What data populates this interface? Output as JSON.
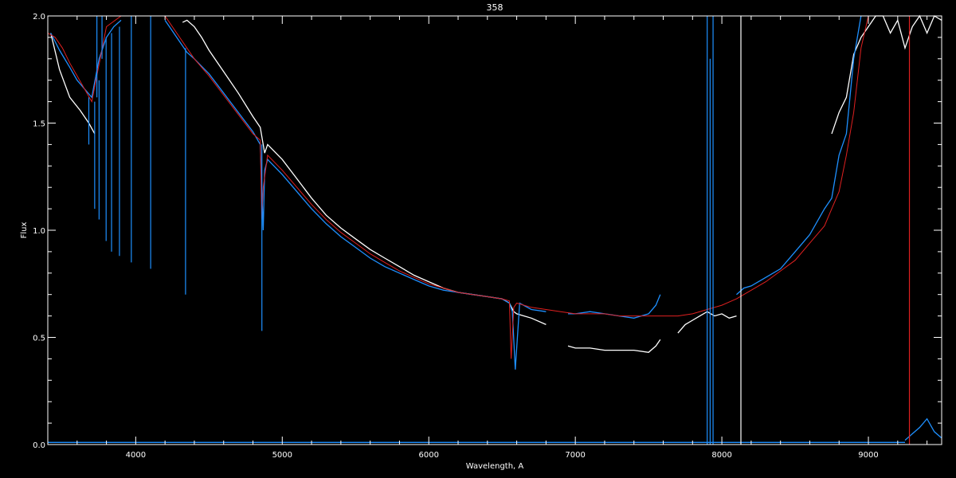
{
  "chart_data": {
    "type": "line",
    "title": "358",
    "xlabel": "Wavelength, A",
    "ylabel": "Flux",
    "xlim": [
      3400,
      9500
    ],
    "ylim": [
      0.0,
      2.0
    ],
    "x_ticks": [
      4000,
      5000,
      6000,
      7000,
      8000,
      9000
    ],
    "x_tick_labels": [
      "4000",
      "5000",
      "6000",
      "7000",
      "8000",
      "9000"
    ],
    "y_ticks": [
      0.0,
      0.5,
      1.0,
      1.5,
      2.0
    ],
    "y_tick_labels": [
      "0.0",
      "0.5",
      "1.0",
      "1.5",
      "2.0"
    ],
    "grid": false,
    "background_color": "#000000",
    "axes_color": "#ffffff",
    "series": [
      {
        "color": "#ffffff",
        "segments": [
          {
            "x": [
              3420,
              3480,
              3550,
              3620,
              3680,
              3720
            ],
            "y": [
              1.92,
              1.75,
              1.62,
              1.56,
              1.5,
              1.45
            ]
          },
          {
            "x": [
              4320,
              4350,
              4400,
              4450,
              4500,
              4600,
              4700,
              4800,
              4850,
              4880,
              4900,
              5000,
              5100,
              5200,
              5300,
              5400,
              5500,
              5600,
              5700,
              5800,
              5900,
              6000,
              6100,
              6200,
              6300,
              6400,
              6500,
              6550,
              6580,
              6600,
              6650,
              6700,
              6800
            ],
            "y": [
              1.97,
              1.98,
              1.95,
              1.9,
              1.84,
              1.74,
              1.64,
              1.53,
              1.48,
              1.36,
              1.4,
              1.33,
              1.24,
              1.15,
              1.07,
              1.01,
              0.96,
              0.91,
              0.87,
              0.83,
              0.79,
              0.76,
              0.73,
              0.71,
              0.7,
              0.69,
              0.68,
              0.66,
              0.62,
              0.61,
              0.6,
              0.59,
              0.56
            ]
          },
          {
            "x": [
              6950,
              7000,
              7100,
              7200,
              7300,
              7400,
              7500,
              7550,
              7580
            ],
            "y": [
              0.46,
              0.45,
              0.45,
              0.44,
              0.44,
              0.44,
              0.43,
              0.46,
              0.49
            ]
          },
          {
            "x": [
              7700,
              7750,
              7800,
              7850,
              7900,
              7950,
              8000,
              8050,
              8100
            ],
            "y": [
              0.52,
              0.56,
              0.58,
              0.6,
              0.62,
              0.6,
              0.61,
              0.59,
              0.6
            ]
          },
          {
            "x": [
              8750,
              8800,
              8850,
              8900,
              8950,
              9000,
              9050,
              9100,
              9150,
              9200,
              9250,
              9300,
              9350,
              9400,
              9450,
              9500
            ],
            "y": [
              1.45,
              1.55,
              1.62,
              1.82,
              1.9,
              1.95,
              2.0,
              2.0,
              1.92,
              1.98,
              1.85,
              1.95,
              2.0,
              1.92,
              2.0,
              1.98
            ]
          }
        ]
      },
      {
        "color": "#1e90ff",
        "segments": [
          {
            "x": [
              3420,
              3480,
              3550,
              3600,
              3650,
              3700,
              3750,
              3800,
              3850,
              3900
            ],
            "y": [
              1.92,
              1.84,
              1.76,
              1.7,
              1.66,
              1.62,
              1.8,
              1.9,
              1.95,
              1.98
            ]
          },
          {
            "x": [
              4200,
              4250,
              4300,
              4350,
              4400,
              4500,
              4600,
              4700,
              4800,
              4850,
              4870,
              4880,
              4900,
              5000,
              5100,
              5200,
              5300,
              5400,
              5500,
              5600,
              5700,
              5800,
              5900,
              6000,
              6100,
              6200,
              6300,
              6400,
              6500,
              6550,
              6570,
              6590,
              6620,
              6700,
              6800
            ],
            "y": [
              1.98,
              1.93,
              1.88,
              1.83,
              1.8,
              1.73,
              1.64,
              1.55,
              1.46,
              1.4,
              1.0,
              1.28,
              1.33,
              1.26,
              1.18,
              1.1,
              1.03,
              0.97,
              0.92,
              0.87,
              0.83,
              0.8,
              0.77,
              0.74,
              0.72,
              0.71,
              0.7,
              0.69,
              0.68,
              0.66,
              0.62,
              0.35,
              0.66,
              0.63,
              0.62
            ]
          },
          {
            "x": [
              6950,
              7000,
              7100,
              7200,
              7300,
              7400,
              7450,
              7500,
              7550,
              7580
            ],
            "y": [
              0.61,
              0.61,
              0.62,
              0.61,
              0.6,
              0.59,
              0.6,
              0.61,
              0.65,
              0.7
            ]
          },
          {
            "x": [
              8100,
              8150,
              8200,
              8300,
              8400,
              8500,
              8600,
              8700,
              8750,
              8800,
              8850,
              8900,
              8950
            ],
            "y": [
              0.7,
              0.73,
              0.74,
              0.78,
              0.82,
              0.9,
              0.98,
              1.1,
              1.15,
              1.35,
              1.45,
              1.8,
              2.0
            ]
          },
          {
            "x": [
              3400,
              4000,
              5000,
              6000,
              7000,
              8000,
              9000,
              9250
            ],
            "y": [
              0.01,
              0.01,
              0.01,
              0.01,
              0.01,
              0.01,
              0.01,
              0.01
            ]
          },
          {
            "x": [
              9250,
              9300,
              9350,
              9400,
              9450,
              9500
            ],
            "y": [
              0.02,
              0.05,
              0.08,
              0.12,
              0.06,
              0.03
            ]
          }
        ]
      },
      {
        "color": "#e02020",
        "segments": [
          {
            "x": [
              3400,
              3450,
              3500,
              3550,
              3600,
              3650,
              3700,
              3800,
              3900,
              4000,
              4100,
              4200,
              4300,
              4400,
              4500,
              4600,
              4700,
              4800,
              4850,
              4860,
              4870,
              4900,
              5000,
              5100,
              5200,
              5300,
              5400,
              5500,
              5600,
              5700,
              5800,
              5900,
              6000,
              6100,
              6200,
              6300,
              6400,
              6500,
              6550,
              6562,
              6580,
              6600,
              6700,
              6800,
              6900,
              7000,
              7100,
              7200,
              7300,
              7400,
              7500,
              7600,
              7700,
              7800,
              7900,
              8000,
              8100,
              8200,
              8300,
              8400,
              8500,
              8600,
              8700,
              8750,
              8800,
              8850,
              8900,
              8950,
              9000,
              9100,
              9200,
              9260
            ],
            "y": [
              1.92,
              1.9,
              1.85,
              1.78,
              1.72,
              1.66,
              1.6,
              1.95,
              2.0,
              2.0,
              2.0,
              2.0,
              1.9,
              1.8,
              1.72,
              1.63,
              1.54,
              1.45,
              1.42,
              1.05,
              1.2,
              1.35,
              1.28,
              1.2,
              1.12,
              1.05,
              0.99,
              0.94,
              0.89,
              0.85,
              0.81,
              0.78,
              0.75,
              0.73,
              0.71,
              0.7,
              0.69,
              0.68,
              0.67,
              0.4,
              0.64,
              0.66,
              0.64,
              0.63,
              0.62,
              0.61,
              0.61,
              0.61,
              0.6,
              0.6,
              0.6,
              0.6,
              0.6,
              0.61,
              0.63,
              0.65,
              0.68,
              0.72,
              0.76,
              0.81,
              0.86,
              0.94,
              1.02,
              1.1,
              1.18,
              1.35,
              1.55,
              1.85,
              2.0,
              2.0,
              2.0,
              2.0
            ]
          }
        ]
      }
    ],
    "spikes": [
      {
        "x": 3680,
        "y_from": 1.62,
        "y_to": 1.4,
        "color": "#1e90ff"
      },
      {
        "x": 3720,
        "y_from": 1.6,
        "y_to": 1.1,
        "color": "#1e90ff"
      },
      {
        "x": 3735,
        "y_from": 1.62,
        "y_to": 2.0,
        "color": "#1e90ff"
      },
      {
        "x": 3750,
        "y_from": 1.7,
        "y_to": 1.05,
        "color": "#1e90ff"
      },
      {
        "x": 3770,
        "y_from": 1.8,
        "y_to": 2.0,
        "color": "#1e90ff"
      },
      {
        "x": 3798,
        "y_from": 1.9,
        "y_to": 0.95,
        "color": "#1e90ff"
      },
      {
        "x": 3835,
        "y_from": 1.92,
        "y_to": 0.9,
        "color": "#1e90ff"
      },
      {
        "x": 3889,
        "y_from": 1.95,
        "y_to": 0.88,
        "color": "#1e90ff"
      },
      {
        "x": 3970,
        "y_from": 2.0,
        "y_to": 0.85,
        "color": "#1e90ff"
      },
      {
        "x": 4102,
        "y_from": 2.0,
        "y_to": 0.82,
        "color": "#1e90ff"
      },
      {
        "x": 4340,
        "y_from": 1.85,
        "y_to": 0.7,
        "color": "#1e90ff"
      },
      {
        "x": 4861,
        "y_from": 1.4,
        "y_to": 0.53,
        "color": "#1e90ff"
      },
      {
        "x": 7900,
        "y_from": 0.0,
        "y_to": 2.0,
        "color": "#1e90ff"
      },
      {
        "x": 7920,
        "y_from": 0.0,
        "y_to": 1.8,
        "color": "#1e90ff"
      },
      {
        "x": 7940,
        "y_from": 0.0,
        "y_to": 2.0,
        "color": "#1e90ff"
      },
      {
        "x": 8130,
        "y_from": 0.0,
        "y_to": 2.0,
        "color": "#ffffff"
      },
      {
        "x": 9280,
        "y_from": 0.0,
        "y_to": 2.0,
        "color": "#e02020"
      }
    ]
  }
}
